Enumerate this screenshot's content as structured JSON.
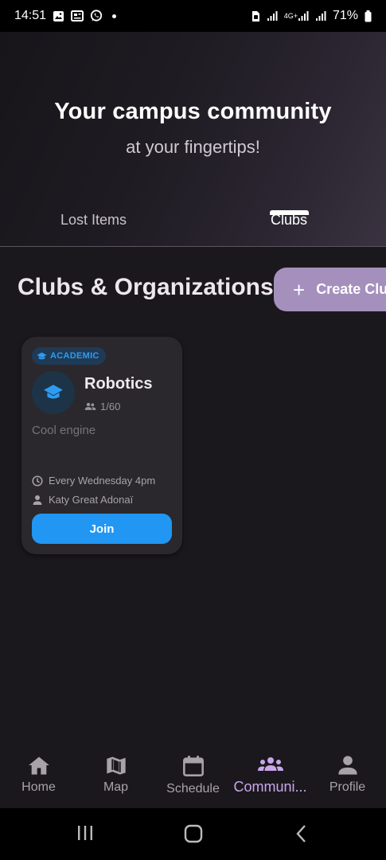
{
  "status_bar": {
    "time": "14:51",
    "battery": "71%",
    "icons": [
      "image-icon",
      "news-icon",
      "whatsapp-icon",
      "dot-icon",
      "sim-icon",
      "signal-icon",
      "4g-signal-icon",
      "signal-icon",
      "battery-icon"
    ],
    "network": "4G+"
  },
  "hero": {
    "title": "Your campus community",
    "subtitle": "at your fingertips!"
  },
  "tabs": [
    {
      "label": "Lost Items",
      "selected": false
    },
    {
      "label": "Clubs",
      "selected": true
    }
  ],
  "section": {
    "title": "Clubs & Organizations",
    "create_label": "Create Clu"
  },
  "clubs": [
    {
      "category": "ACADEMIC",
      "category_icon": "graduation-cap-icon",
      "name": "Robotics",
      "members": "1/60",
      "description": "Cool engine",
      "schedule": "Every Wednesday 4pm",
      "owner": "Katy Great Adonaï",
      "join_label": "Join"
    }
  ],
  "bottom_nav": [
    {
      "label": "Home",
      "icon": "home-icon",
      "active": false
    },
    {
      "label": "Map",
      "icon": "map-icon",
      "active": false
    },
    {
      "label": "Schedule",
      "icon": "calendar-icon",
      "active": false
    },
    {
      "label": "Communi...",
      "icon": "groups-icon",
      "active": true
    },
    {
      "label": "Profile",
      "icon": "person-icon",
      "active": false
    }
  ],
  "colors": {
    "accent": "#2196f3",
    "create_button": "#a48fbd",
    "active_nav": "#c9a6ec",
    "background": "#1b181d",
    "card": "#2a282c"
  }
}
